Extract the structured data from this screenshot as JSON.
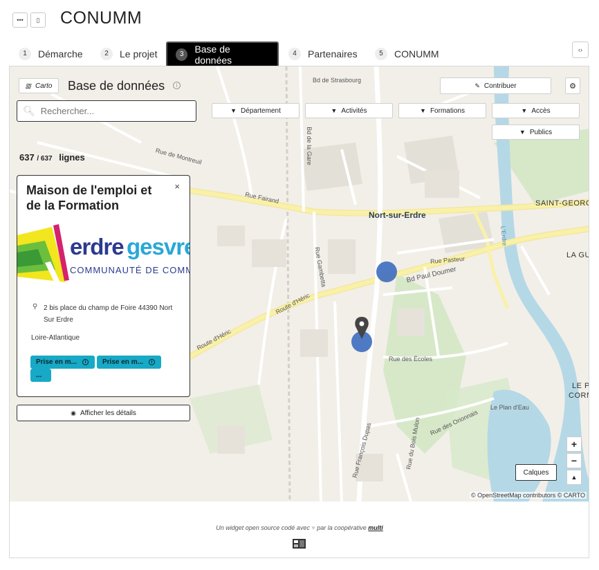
{
  "header": {
    "title": "CONUMM",
    "btn_left_icon": "ellipsis-icon",
    "btn_right_icon": "sidebar-icon"
  },
  "tabs": [
    {
      "num": "1",
      "label": "Démarche"
    },
    {
      "num": "2",
      "label": "Le projet"
    },
    {
      "num": "3",
      "label": "Base de données"
    },
    {
      "num": "4",
      "label": "Partenaires"
    },
    {
      "num": "5",
      "label": "CONUMM"
    }
  ],
  "active_tab": 2,
  "collapse_icon": "‹›",
  "panel": {
    "carto_label": "Carto",
    "title": "Base de données",
    "search_placeholder": "Rechercher...",
    "count_shown": "637",
    "count_total": "/ 637",
    "count_unit": "lignes",
    "contribute_label": "Contribuer"
  },
  "filters": [
    "Département",
    "Activités",
    "Formations",
    "Accès",
    "Publics"
  ],
  "card": {
    "title": "Maison de l'emploi et de la Formation",
    "close": "×",
    "logo_text_1": "erdre",
    "logo_text_2": "gesvres",
    "logo_subtitle": "COMMUNAUTÉ DE COMMUNES",
    "address": "2 bis place du champ de Foire 44390 Nort Sur Erdre",
    "region": "Loire-Atlantique",
    "tags": [
      "Prise en m...",
      "Prise en m...",
      "..."
    ],
    "details_label": "Afficher les détails"
  },
  "map": {
    "labels": {
      "bd_strasbourg": "Bd de Strasbourg",
      "rue_fairand": "Rue Fairand",
      "nort_sur_erdre": "Nort-sur-Erdre",
      "saint_georges": "SAINT-GEORG",
      "la_gu": "LA GU",
      "bd_paul_doumer": "Bd Paul Doumer",
      "route_heric_1": "Route d'Héric",
      "route_heric_2": "Route d'Héric",
      "rue_gambetta": "Rue Gambetta",
      "rue_francois_dupas": "Rue François Dupas",
      "le_plan_deau": "Le Plan d'Eau",
      "le_p": "LE P",
      "corn": "CORN",
      "rue_des_ecoles": "Rue des Écoles",
      "bd_de_la_gare": "Bd de la Gare",
      "rue_de_montreuil": "Rue de Montreuil",
      "rue_pasteur": "Rue Pasteur",
      "rue_des_orionnais": "Rue des Orionnais",
      "rue_du_bois_mulon": "Rue du Bois Mulon",
      "lerdre": "L'Erdre"
    },
    "zoom_in": "+",
    "zoom_out": "−",
    "north": "▲",
    "layers_label": "Calques",
    "attribution": "© OpenStreetMap contributors © CARTO"
  },
  "footer": {
    "text_before": "Un widget open source codé avec",
    "heart": "♥",
    "text_middle": "par la coopérative",
    "brand": "multi"
  },
  "colors": {
    "accent_tag": "#17a9c6",
    "marker": "#3d6bbf",
    "water": "#b5d8e6",
    "park": "#d6e8c8",
    "road_major": "#f9f1a8"
  }
}
